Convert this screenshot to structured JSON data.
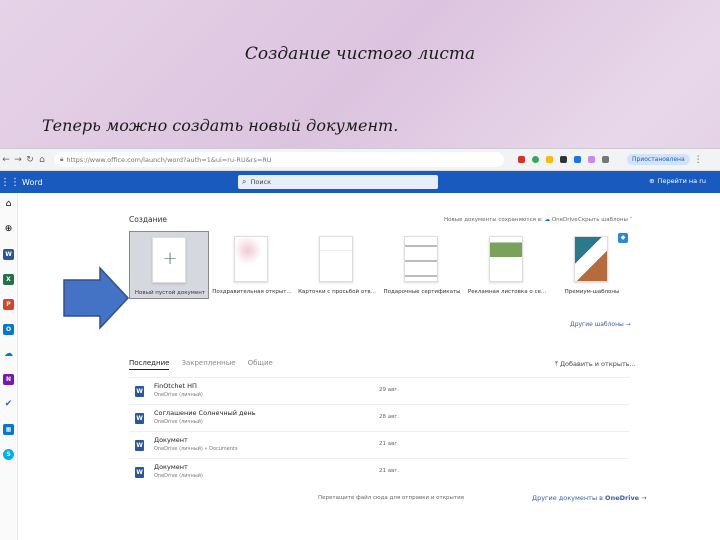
{
  "slide": {
    "title": "Создание чистого листа",
    "subtitle": "Теперь можно создать новый документ."
  },
  "browser": {
    "url": "https://www.office.com/launch/word?auth=1&ui=ru-RU&rs=RU",
    "paused_label": "Приостановлена"
  },
  "office": {
    "app_name": "Word",
    "search_placeholder": "Поиск",
    "translate_label": "Перейти на ru"
  },
  "create": {
    "title": "Создание",
    "save_note": "Новые документы сохраняются в:",
    "onedrive": "OneDrive",
    "hide_templates": "Скрыть шаблоны",
    "more_templates": "Другие шаблоны",
    "tiles": [
      {
        "label": "Новый пустой документ"
      },
      {
        "label": "Поздравительная открыт..."
      },
      {
        "label": "Карточки с просьбой отв..."
      },
      {
        "label": "Подарочные сертификаты"
      },
      {
        "label": "Рекламная листовка о се..."
      },
      {
        "label": "Премиум-шаблоны"
      }
    ]
  },
  "recent": {
    "tabs": [
      "Последние",
      "Закрепленные",
      "Общие"
    ],
    "add_open": "Добавить и открыть...",
    "files": [
      {
        "name": "FinOtchet НП",
        "location": "OneDrive (личный)",
        "date": "29 авг."
      },
      {
        "name": "Соглашение Солнечный день",
        "location": "OneDrive (личный)",
        "date": "28 авг."
      },
      {
        "name": "Документ",
        "location": "OneDrive (личный) » Documents",
        "date": "21 авг."
      },
      {
        "name": "Документ",
        "location": "OneDrive (личный)",
        "date": "21 авг."
      }
    ],
    "drop_hint": "Перетащите файл сюда для отправки и открытия",
    "more_docs": "Другие документы в",
    "more_docs_service": "OneDrive"
  },
  "colors": {
    "office_blue": "#185abd",
    "arrow_blue": "#4472c4"
  }
}
